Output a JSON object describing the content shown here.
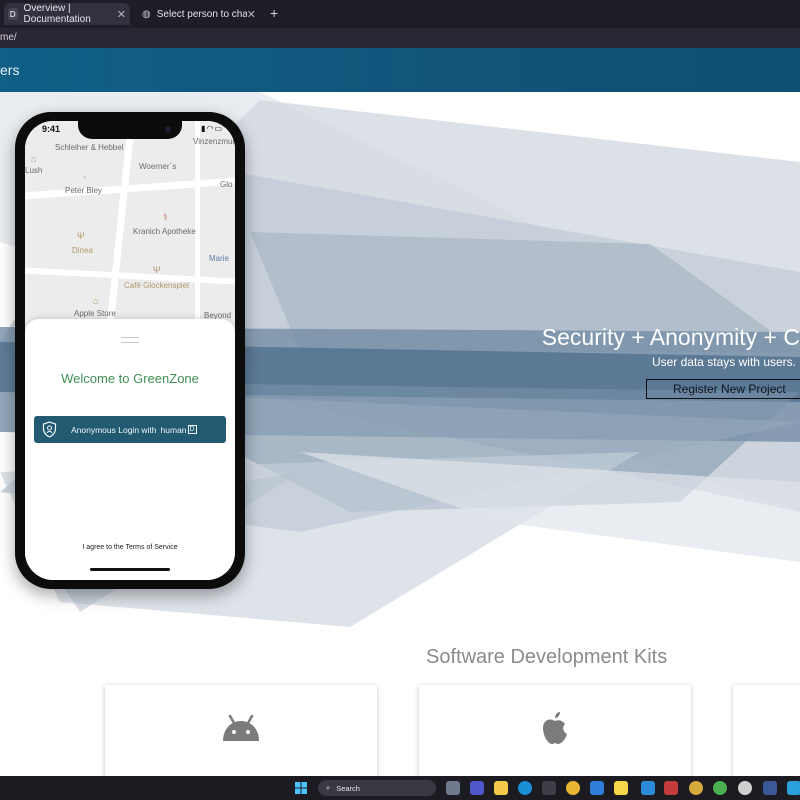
{
  "browser": {
    "tabs": [
      {
        "favicon": "D",
        "label": "Overview | Documentation",
        "active": true
      },
      {
        "favicon": "globe-icon",
        "label": "Select person to change | Djang",
        "active": false
      }
    ],
    "new_tab": "+",
    "address": "me/"
  },
  "site_header": {
    "text": "ers",
    "color": "#115479"
  },
  "hero": {
    "title": "Security + Anonymity + C",
    "subtitle": "User data stays with users.",
    "register_label": "Register New Project"
  },
  "phone": {
    "status_time": "9:41",
    "map_places": [
      "Schleiher & Hebbel",
      "Woerner´s",
      "Lush",
      "Vinzenzmurr",
      "Peter Bley",
      "Glo",
      "Kranich Apotheke",
      "Dinea",
      "Marie",
      "Café Glockenspiel",
      "Apple Store",
      "Beyond"
    ],
    "welcome": "Welcome to GreenZone",
    "anon_login_prefix": "Anonymous Login with",
    "anon_login_brand": "human",
    "anon_login_brand_box": "D",
    "terms": "I agree to the Terms of Service",
    "welcome_color": "#3f8f52",
    "button_color": "#225a72"
  },
  "sdk": {
    "title": "Software Development Kits",
    "cards": [
      {
        "icon": "android-icon"
      },
      {
        "icon": "apple-icon"
      },
      {
        "icon": ""
      }
    ]
  },
  "taskbar": {
    "search_label": "Search"
  }
}
